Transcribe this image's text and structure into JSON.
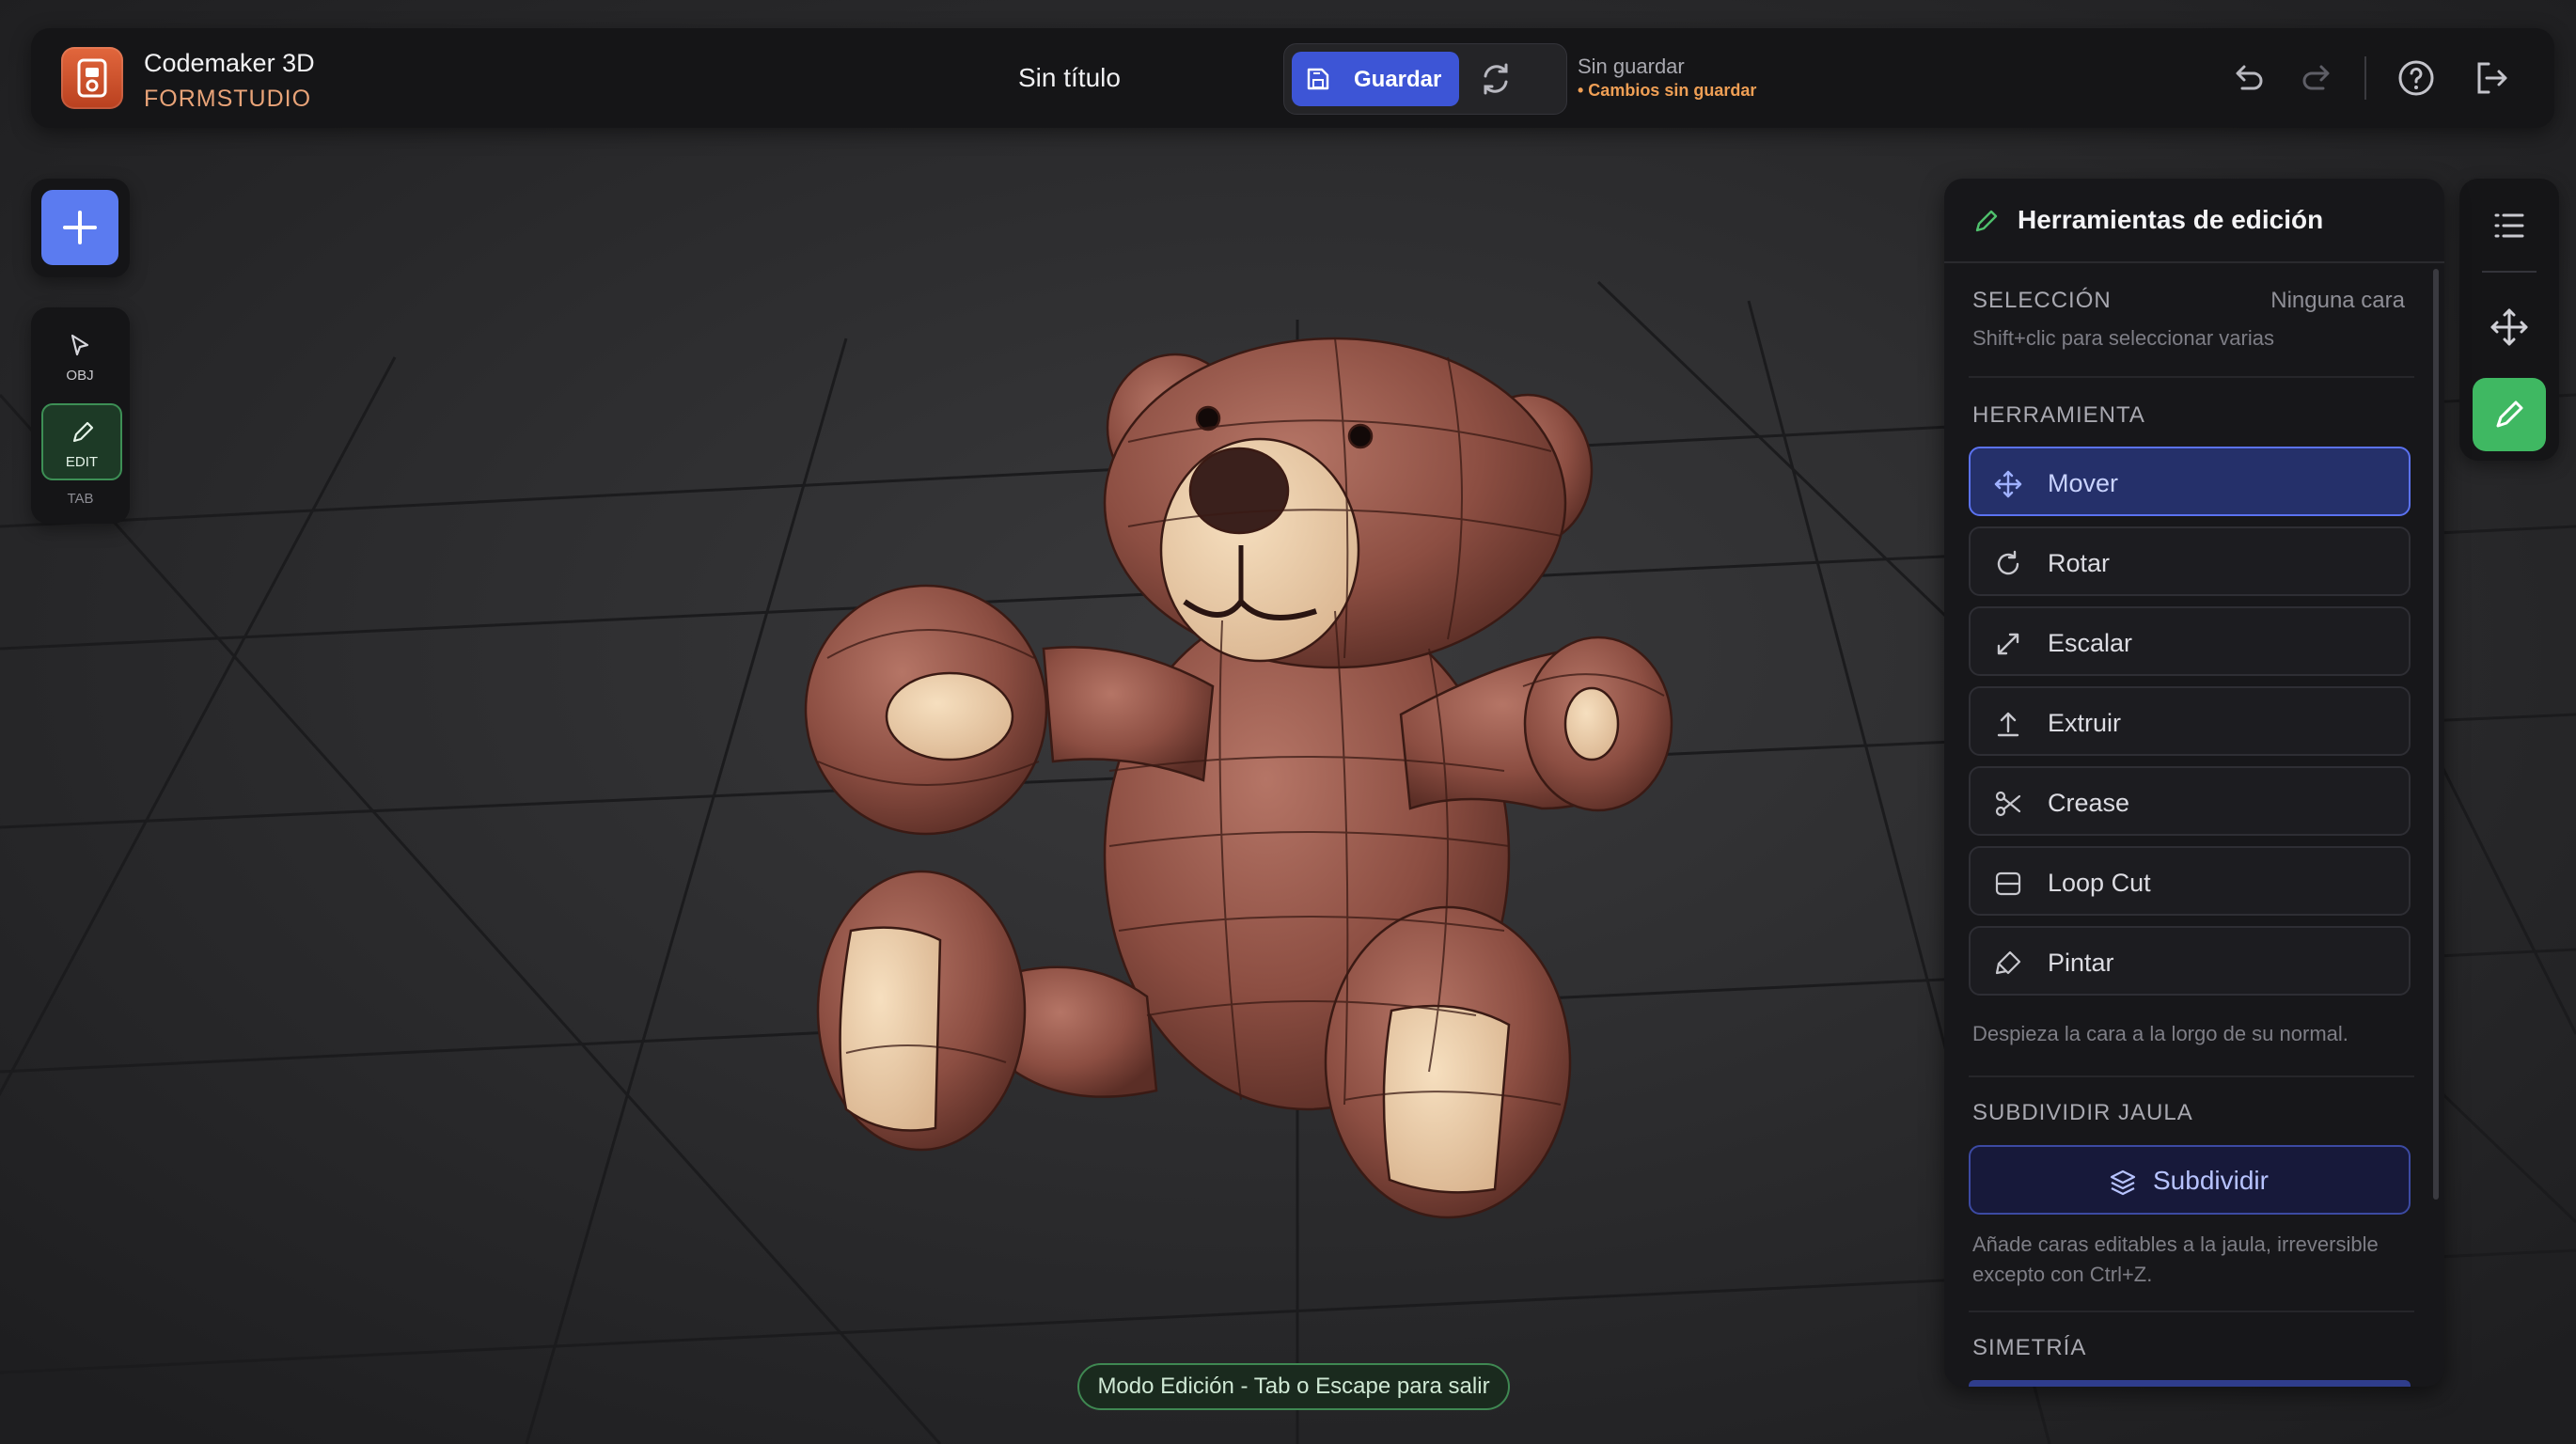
{
  "app": {
    "name": "Codemaker 3D",
    "subtitle": "FORMSTUDIO"
  },
  "document": {
    "title": "Sin título"
  },
  "save": {
    "label": "Guardar",
    "status": "Sin guardar",
    "note": "• Cambios sin guardar"
  },
  "toolbar_icons": [
    "undo-icon",
    "redo-icon",
    "help-icon",
    "exit-icon"
  ],
  "left_tools": {
    "add_icon": "plus-icon",
    "obj_label": "OBJ",
    "edit_label": "EDIT",
    "tab_hint": "TAB"
  },
  "right_tools": [
    "list-icon",
    "move-icon",
    "pencil-icon"
  ],
  "edit_panel": {
    "title": "Herramientas de edición",
    "selection": {
      "label": "SELECCIÓN",
      "value": "Ninguna cara",
      "hint": "Shift+clic para seleccionar varias"
    },
    "tool_section": "HERRAMIENTA",
    "tools": [
      {
        "label": "Mover",
        "icon": "move-icon",
        "active": true
      },
      {
        "label": "Rotar",
        "icon": "rotate-icon",
        "active": false
      },
      {
        "label": "Escalar",
        "icon": "scale-icon",
        "active": false
      },
      {
        "label": "Extruir",
        "icon": "extrude-icon",
        "active": false
      },
      {
        "label": "Crease",
        "icon": "scissors-icon",
        "active": false
      },
      {
        "label": "Loop Cut",
        "icon": "loop-cut-icon",
        "active": false
      },
      {
        "label": "Pintar",
        "icon": "paint-icon",
        "active": false
      }
    ],
    "tool_hint": "Despieza la cara a la lorgo de su normal.",
    "subdivide": {
      "section": "SUBDIVIDIR JAULA",
      "button": "Subdividir",
      "hint_line1": "Añade caras editables a la jaula, irreversible",
      "hint_line2": "excepto con Ctrl+Z."
    },
    "symmetry_section": "SIMETRÍA"
  },
  "status_bar": {
    "text": "Modo Edición - Tab o Escape para salir"
  },
  "colors": {
    "accent": "#3d55d6",
    "edit_green": "#3fb862",
    "warning": "#ef9f55",
    "background": "#2a2a2c"
  }
}
